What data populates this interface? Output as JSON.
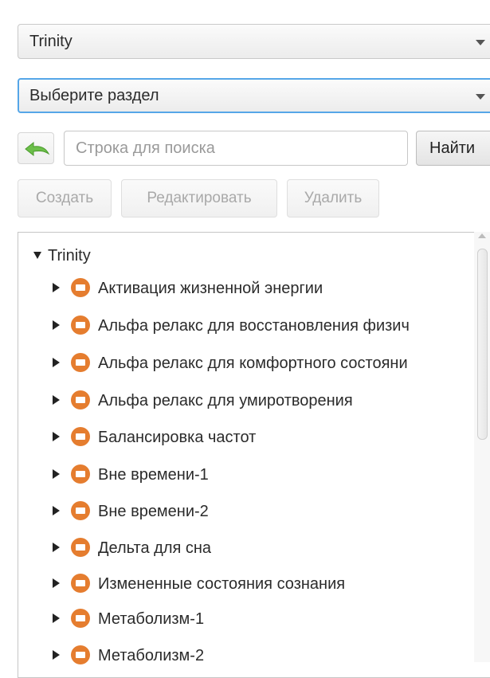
{
  "combo_player": {
    "value": "Trinity"
  },
  "combo_section": {
    "value": "Выберите раздел"
  },
  "search": {
    "placeholder": "Строка для поиска",
    "value": "",
    "button_label": "Найти"
  },
  "actions": {
    "create_label": "Создать",
    "edit_label": "Редактировать",
    "delete_label": "Удалить"
  },
  "tree": {
    "root_label": "Trinity",
    "items": [
      {
        "label": "Активация жизненной энергии"
      },
      {
        "label": "Альфа релакс для восстановления физич"
      },
      {
        "label": "Альфа релакс для комфортного состояни"
      },
      {
        "label": "Альфа релакс для умиротворения"
      },
      {
        "label": "Балансировка частот"
      },
      {
        "label": "Вне времени-1"
      },
      {
        "label": "Вне времени-2"
      },
      {
        "label": "Дельта для сна"
      },
      {
        "label": "Измененные состояния сознания"
      },
      {
        "label": "Метаболизм-1"
      },
      {
        "label": "Метаболизм-2"
      }
    ]
  },
  "colors": {
    "accent": "#55a6e8",
    "node_icon": "#e57d2f",
    "back_arrow": "#6cbf4a"
  },
  "icons": {
    "back": "back-arrow-icon",
    "node": "program-node-icon"
  }
}
